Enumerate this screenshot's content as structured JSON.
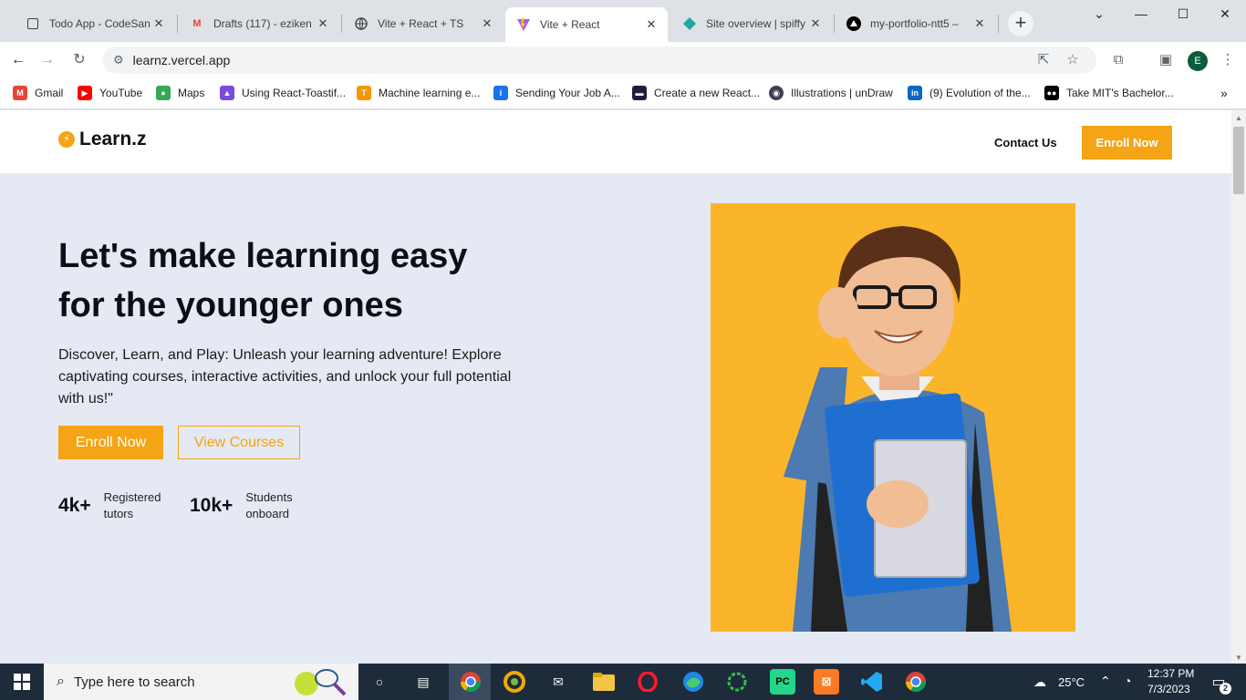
{
  "browser": {
    "tabs": [
      {
        "title": "Todo App - CodeSan",
        "icon": "square-icon"
      },
      {
        "title": "Drafts (117) - eziken",
        "icon": "gmail-icon"
      },
      {
        "title": "Vite + React + TS",
        "icon": "globe-icon"
      },
      {
        "title": "Vite + React",
        "icon": "vite-icon",
        "active": true
      },
      {
        "title": "Site overview | spiffy",
        "icon": "netlify-icon"
      },
      {
        "title": "my-portfolio-ntt5 –",
        "icon": "vercel-icon"
      }
    ],
    "new_tab": "+",
    "url": "learnz.vercel.app",
    "profile_initial": "E",
    "bookmarks": [
      {
        "label": "Gmail",
        "color": "#ea4335"
      },
      {
        "label": "YouTube",
        "color": "#ff0000"
      },
      {
        "label": "Maps",
        "color": "#34a853"
      },
      {
        "label": "Using React-Toastif...",
        "color": "#7b4ae2"
      },
      {
        "label": "Machine learning e...",
        "color": "#f29900"
      },
      {
        "label": "Sending Your Job A...",
        "color": "#1a73e8"
      },
      {
        "label": "Create a new React...",
        "color": "#1d1f3a"
      },
      {
        "label": "Illustrations | unDraw",
        "color": "#3f3d56"
      },
      {
        "label": "(9) Evolution of the...",
        "color": "#0a66c2"
      },
      {
        "label": "Take MIT's Bachelor...",
        "color": "#000000"
      }
    ]
  },
  "site": {
    "logo": "Learn.z",
    "nav_contact": "Contact Us",
    "nav_enroll": "Enroll Now",
    "hero_title_line1": "Let's make learning easy",
    "hero_title_line2": "for the younger ones",
    "hero_description": "Discover, Learn, and Play: Unleash your learning adventure! Explore captivating courses, interactive activities, and unlock your full potential with us!\"",
    "btn_enroll": "Enroll Now",
    "btn_view": "View Courses",
    "stats": [
      {
        "number": "4k+",
        "label": "Registered tutors"
      },
      {
        "number": "10k+",
        "label": "Students onboard"
      }
    ],
    "accent_color": "#f5a415"
  },
  "taskbar": {
    "search_placeholder": "Type here to search",
    "weather": "25°C",
    "time": "12:37 PM",
    "date": "7/3/2023",
    "notifications": "2"
  }
}
